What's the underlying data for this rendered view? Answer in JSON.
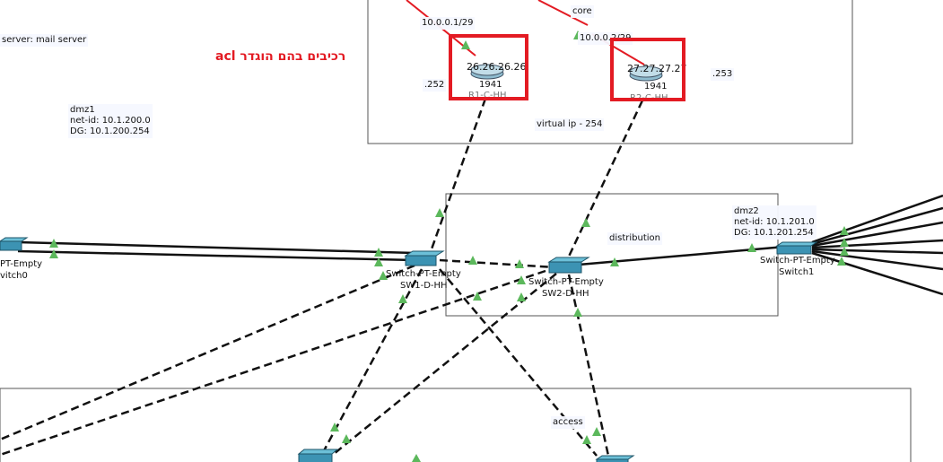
{
  "colors": {
    "switch_body": "#3c93b3",
    "switch_top": "#6cc0d8",
    "router": "#8fbccf",
    "link_up": "#5cb85c",
    "highlight": "#e31b23",
    "zone_border": "#555555",
    "label_bg": "#f5f8ff"
  },
  "notes": {
    "mail_server": "server: mail server",
    "acl": "רכיבים בהם הוגדר acl",
    "virtual_ip": "virtual ip - 254",
    "dmz1": "dmz1\nnet-id: 10.1.200.0\nDG: 10.1.200.254",
    "dmz2": "dmz2\nnet-id: 10.1.201.0\nDG: 10.1.201.254"
  },
  "zones": {
    "core": "core",
    "distribution": "distribution",
    "access": "access"
  },
  "ips": {
    "link_left": "10.0.0.1/29",
    "link_right": "10.0.0.2/29",
    "r1_suffix": ".252",
    "r2_suffix": ".253"
  },
  "routers": [
    {
      "loopback": "26.26.26.26",
      "model": "1941",
      "name": "R1-C-HH"
    },
    {
      "loopback": "27.27.27.27",
      "model": "1941",
      "name": "R2-C-HH"
    }
  ],
  "switches": {
    "sw1": {
      "type": "Switch-PT-Empty",
      "name": "SW1-D-HH"
    },
    "sw2": {
      "type": "Switch-PT-Empty",
      "name": "SW2-D-HH"
    },
    "switch0": {
      "type": "PT-Empty",
      "name": "vitch0"
    },
    "switch1": {
      "type": "Switch-PT-Empty",
      "name": "Switch1"
    }
  }
}
